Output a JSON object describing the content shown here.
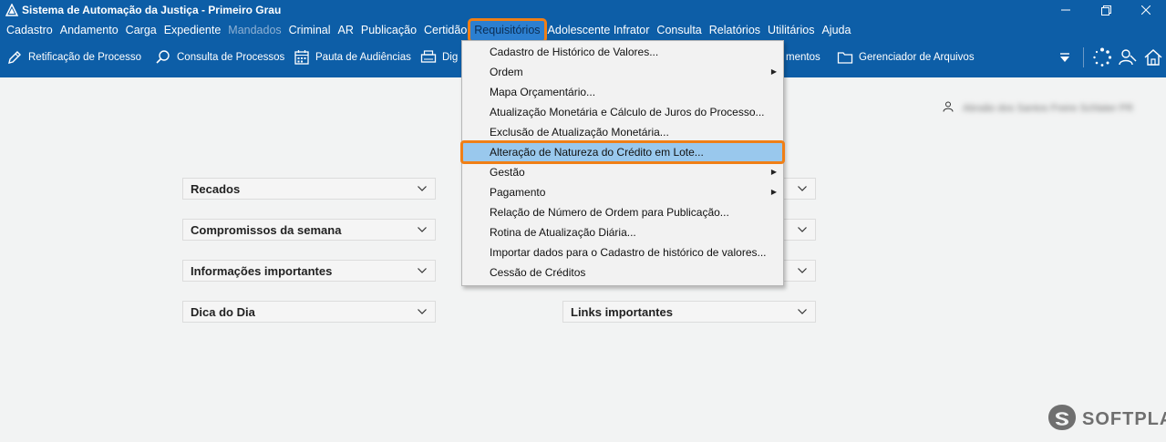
{
  "window": {
    "title": "Sistema de Automação da Justiça - Primeiro Grau"
  },
  "menubar": [
    {
      "label": "Cadastro"
    },
    {
      "label": "Andamento"
    },
    {
      "label": "Carga"
    },
    {
      "label": "Expediente"
    },
    {
      "label": "Mandados",
      "disabled": true
    },
    {
      "label": "Criminal"
    },
    {
      "label": "AR"
    },
    {
      "label": "Publicação"
    },
    {
      "label": "Certidão"
    },
    {
      "label": "Requisitórios",
      "active": true
    },
    {
      "label": "Adolescente Infrator"
    },
    {
      "label": "Consulta"
    },
    {
      "label": "Relatórios"
    },
    {
      "label": "Utilitários"
    },
    {
      "label": "Ajuda"
    }
  ],
  "toolbar": {
    "retificacao": "Retificação de Processo",
    "consulta": "Consulta de Processos",
    "pauta": "Pauta de Audiências",
    "dig": "Dig",
    "mentos": "mentos",
    "gerenciador": "Gerenciador de Arquivos"
  },
  "dropdown": {
    "items": [
      {
        "label": "Cadastro de Histórico de Valores...",
        "submenu": false
      },
      {
        "label": "Ordem",
        "submenu": true
      },
      {
        "label": "Mapa Orçamentário...",
        "submenu": false
      },
      {
        "label": "Atualização Monetária e Cálculo de Juros do Processo...",
        "submenu": false
      },
      {
        "label": "Exclusão de Atualização Monetária...",
        "submenu": false
      },
      {
        "label": "Alteração de Natureza do Crédito em Lote...",
        "submenu": false,
        "highlighted": true
      },
      {
        "label": "Gestão",
        "submenu": true
      },
      {
        "label": "Pagamento",
        "submenu": true
      },
      {
        "label": "Relação de Número de Ordem para Publicação...",
        "submenu": false
      },
      {
        "label": "Rotina de Atualização Diária...",
        "submenu": false
      },
      {
        "label": "Importar dados para o Cadastro de histórico de valores...",
        "submenu": false
      },
      {
        "label": "Cessão de Créditos",
        "submenu": false
      }
    ],
    "submenu_arrow": "▶"
  },
  "user": {
    "name": "Abraão dos Santos Freire Schlater PR"
  },
  "panels": {
    "recados": "Recados",
    "compromissos": "Compromissos da semana",
    "informacoes": "Informações importantes",
    "dica": "Dica do Dia",
    "links": "Links importantes"
  },
  "brand": {
    "name": "SOFTPLAN"
  },
  "colors": {
    "primary": "#0d5ea7",
    "highlight": "#99c8ed",
    "annotation": "#f07f16"
  }
}
